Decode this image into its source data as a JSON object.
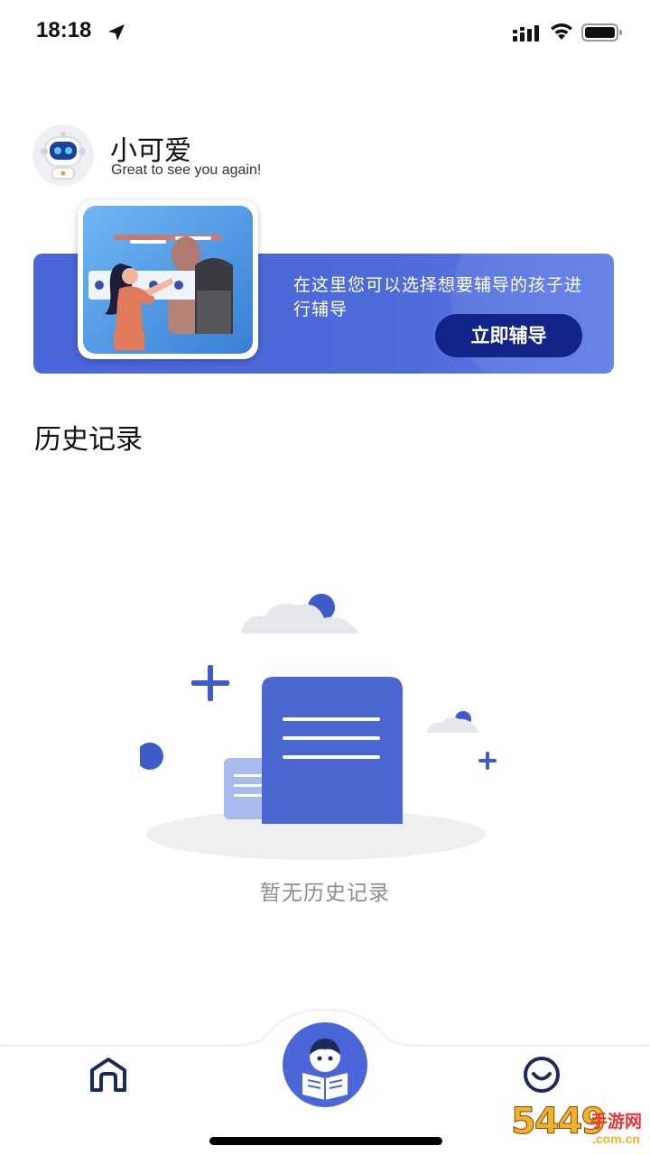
{
  "status_bar": {
    "time": "18:18",
    "icons": [
      "location-arrow-icon",
      "cellular-signal-icon",
      "wifi-icon",
      "battery-icon"
    ]
  },
  "header": {
    "user_name": "小可爱",
    "greeting": "Great to see you again!",
    "avatar": "robot-avatar"
  },
  "banner": {
    "text": "在这里您可以选择想要辅导的孩子进行辅导",
    "button_label": "立即辅导",
    "illustration": "girl-pointing-at-board-illustration"
  },
  "history": {
    "title": "历史记录",
    "empty_text": "暂无历史记录",
    "empty_illustration": "empty-document-illustration"
  },
  "tab_bar": {
    "items": [
      {
        "name": "home",
        "icon": "home-icon"
      },
      {
        "name": "tutor",
        "icon": "reading-kid-icon"
      },
      {
        "name": "profile",
        "icon": "smiley-icon"
      }
    ]
  },
  "watermark": {
    "digits": "5449",
    "site_name": "手游网",
    "domain": ".com.cn"
  },
  "colors": {
    "accent": "#4a66d8",
    "accent_dark": "#12248a",
    "text_primary": "#111111",
    "text_muted": "#8c8c90",
    "nav_icon": "#1c2a57"
  }
}
